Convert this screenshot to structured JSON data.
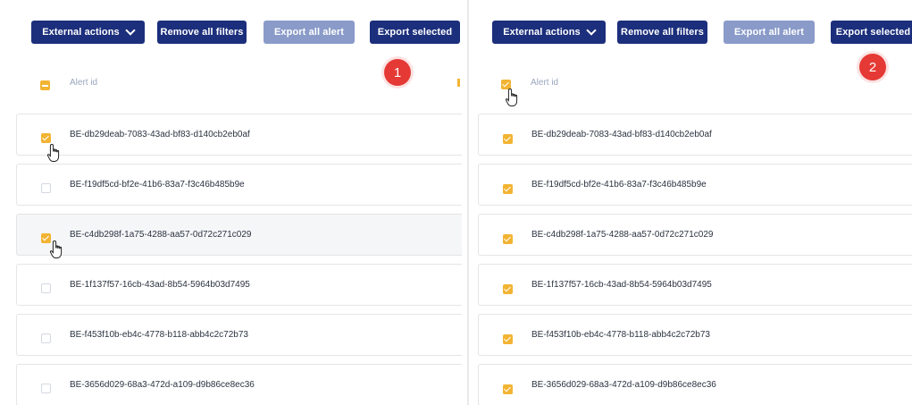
{
  "panels": [
    {
      "step": "1",
      "toolbar": {
        "external_actions": "External actions",
        "remove_filters": "Remove all filters",
        "export_all": "Export all alert",
        "export_selected": "Export selected"
      },
      "header": {
        "column_label": "Alert id",
        "select_all_state": "partial"
      },
      "rows": [
        {
          "id": "BE-db29deab-7083-43ad-bf83-d140cb2eb0af",
          "checked": true
        },
        {
          "id": "BE-f19df5cd-bf2e-41b6-83a7-f3c46b485b9e",
          "checked": false
        },
        {
          "id": "BE-c4db298f-1a75-4288-aa57-0d72c271c029",
          "checked": true
        },
        {
          "id": "BE-1f137f57-16cb-43ad-8b54-5964b03d7495",
          "checked": false
        },
        {
          "id": "BE-f453f10b-eb4c-4778-b118-abb4c2c72b73",
          "checked": false
        },
        {
          "id": "BE-3656d029-68a3-472d-a109-d9b86ce8ec36",
          "checked": false
        }
      ]
    },
    {
      "step": "2",
      "toolbar": {
        "external_actions": "External actions",
        "remove_filters": "Remove all filters",
        "export_all": "Export all alert",
        "export_selected": "Export selected"
      },
      "header": {
        "column_label": "Alert id",
        "select_all_state": "checked"
      },
      "rows": [
        {
          "id": "BE-db29deab-7083-43ad-bf83-d140cb2eb0af",
          "checked": true
        },
        {
          "id": "BE-f19df5cd-bf2e-41b6-83a7-f3c46b485b9e",
          "checked": true
        },
        {
          "id": "BE-c4db298f-1a75-4288-aa57-0d72c271c029",
          "checked": true
        },
        {
          "id": "BE-1f137f57-16cb-43ad-8b54-5964b03d7495",
          "checked": true
        },
        {
          "id": "BE-f453f10b-eb4c-4778-b118-abb4c2c72b73",
          "checked": true
        },
        {
          "id": "BE-3656d029-68a3-472d-a109-d9b86ce8ec36",
          "checked": true
        }
      ]
    }
  ],
  "icons": {
    "dropdown": "chevron-down-icon",
    "pointer": "hand-pointer-icon",
    "more": "kebab-menu-icon"
  },
  "colors": {
    "primary": "#1c2f7c",
    "disabled": "#8a9bc9",
    "accent": "#f2b433",
    "badge": "#e53935"
  }
}
